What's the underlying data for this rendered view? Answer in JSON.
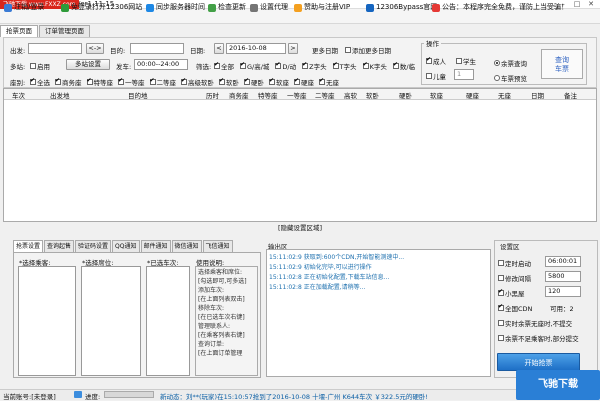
{
  "window": {
    "badge": "飞驰下载 www.FXXZ.com",
    "title": "/er1.11.15",
    "min_glyph": "–",
    "max_glyph": "□",
    "close_glyph": "✕"
  },
  "toolbar": {
    "items": [
      {
        "label": "注销/登录"
      },
      {
        "label": "免登录打开12306网站"
      },
      {
        "label": "同步服务器时间"
      },
      {
        "label": "检查更新"
      },
      {
        "label": "设置代理"
      },
      {
        "label": "赞助与注册VIP"
      },
      {
        "label": "12306Bypass官网"
      },
      {
        "label": "公告：本程序完全免费，谨防上当受骗！"
      }
    ]
  },
  "tabs": [
    "抢票页面",
    "订单管理页面"
  ],
  "query": {
    "from_label": "出发:",
    "to_label": "目的:",
    "swap_label": "<->",
    "date_label": "日期:",
    "date_prev": "<",
    "date_value": "2016-10-08",
    "date_next": ">",
    "more_dates_label": "更多日期",
    "add_more_dates_label": "添加更多日期",
    "multi_station_label": "多站:",
    "enable_label": "启用",
    "multi_station_settings": "多站设置",
    "depart_time_label": "发车:",
    "depart_time_value": "00:00--24:00",
    "filter_label": "筛选:",
    "filters": [
      {
        "label": "全部",
        "checked": true
      },
      {
        "label": "G/高/城",
        "checked": true
      },
      {
        "label": "D/动",
        "checked": true
      },
      {
        "label": "Z字头",
        "checked": true
      },
      {
        "label": "T字头",
        "checked": true
      },
      {
        "label": "K字头",
        "checked": true
      },
      {
        "label": "数/临",
        "checked": true
      }
    ],
    "seat_label": "座别:",
    "seats": [
      {
        "label": "全选",
        "checked": true
      },
      {
        "label": "商务座",
        "checked": true
      },
      {
        "label": "特等座",
        "checked": true
      },
      {
        "label": "一等座",
        "checked": true
      },
      {
        "label": "二等座",
        "checked": true
      },
      {
        "label": "高级软卧",
        "checked": true
      },
      {
        "label": "软卧",
        "checked": true
      },
      {
        "label": "硬卧",
        "checked": true
      },
      {
        "label": "软座",
        "checked": true
      },
      {
        "label": "硬座",
        "checked": true
      },
      {
        "label": "无座",
        "checked": true
      }
    ]
  },
  "operation": {
    "title": "操作",
    "adult_label": "成人",
    "adult_checked": true,
    "student_label": "学生",
    "student_checked": false,
    "child_label": "儿童",
    "child_checked": false,
    "child_count": "1",
    "mode_ticket_query": "余票查询",
    "mode_ticket_query_selected": true,
    "mode_preview": "车票预览",
    "mode_preview_selected": false,
    "query_button": "查询\n车票"
  },
  "grid": {
    "columns": [
      "车次",
      "出发地",
      "目的地",
      "历时",
      "商务座",
      "特等座",
      "一等座",
      "二等座",
      "高软",
      "软卧",
      "硬卧",
      "软座",
      "硬座",
      "无座",
      "日期",
      "备注"
    ]
  },
  "hide_settings": "[隐藏设置区域]",
  "bottom_tabs": [
    "抢票设置",
    "查询起售",
    "验证码设置",
    "QQ通知",
    "邮件通知",
    "微信通知",
    "飞信通知"
  ],
  "ticket_settings": {
    "passenger_label": "*选择乘客:",
    "seat_label": "*选择席位:",
    "train_label": "*已选车次:",
    "usage_label": "使用说明:",
    "usage_text": [
      "选择乘客和席位:",
      "[勾选即可,可多选]",
      "添加车次:",
      "[在上面列表双击]",
      "移除车次:",
      "[在已选车次右键]",
      "管理联系人:",
      "[在乘客列表右键]",
      "查询订单:",
      "[在上面订单管理"
    ]
  },
  "output": {
    "title": "输出区",
    "lines": [
      {
        "time": "15:11:02:9",
        "text": "获取到:600个CDN,开始智能测速中..."
      },
      {
        "time": "15:11:02:9",
        "text": "初始化完毕,可以进行操作"
      },
      {
        "time": "15:11:02:8",
        "text": "正在初始化配置,下载车站信息..."
      },
      {
        "time": "15:11:02:8",
        "text": "正在加载配置,请稍等..."
      }
    ]
  },
  "settings": {
    "title": "设置区",
    "timed_start": {
      "label": "定时启动",
      "checked": false,
      "value": "06:00:01"
    },
    "refresh_interval": {
      "label": "修改间隔",
      "checked": false,
      "value": "5800"
    },
    "black_room": {
      "label": "小黑屋",
      "checked": true,
      "value": "120"
    },
    "all_cdn": {
      "label": "全国CDN",
      "checked": true,
      "available_label": "可用：2"
    },
    "no_seat_submit": {
      "label": "实时余票无座时,不提交",
      "checked": false
    },
    "partial_submit": {
      "label": "余票不足乘客时,部分提交",
      "checked": false
    },
    "start_button": "开始抢票"
  },
  "status": {
    "account": "当前账号:[未登录]",
    "progress_label": "进度:",
    "progress_fraction": 0.0,
    "news": "新动态：刘**(玩家)在15:10:57抢到了2016-10-08 十堰-广州 K644车次 ￥322.5元的硬卧!"
  },
  "watermark": "飞驰下载"
}
